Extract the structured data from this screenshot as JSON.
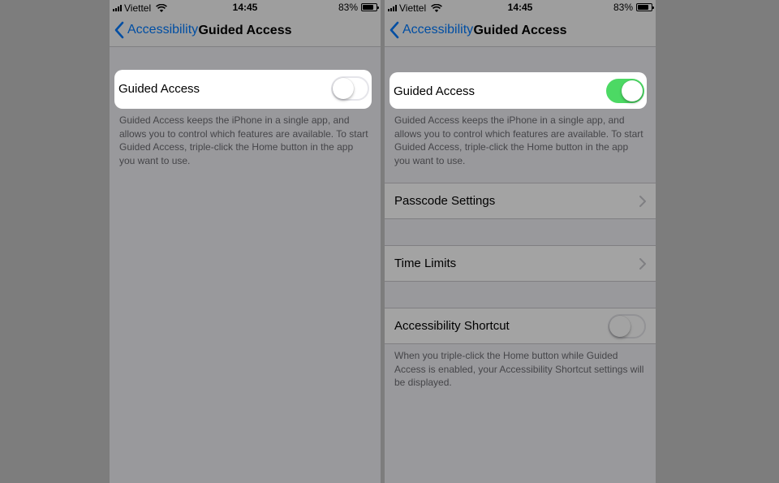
{
  "status_bar": {
    "carrier": "Viettel",
    "time": "14:45",
    "battery_percent": "83%",
    "battery_level": 0.83
  },
  "nav": {
    "back_label": "Accessibility",
    "title": "Guided Access"
  },
  "guided_access": {
    "label": "Guided Access",
    "description": "Guided Access keeps the iPhone in a single app, and allows you to control which features are available. To start Guided Access, triple-click the Home button in the app you want to use."
  },
  "left_screen": {
    "guided_access_enabled": false
  },
  "right_screen": {
    "guided_access_enabled": true,
    "passcode_settings_label": "Passcode Settings",
    "time_limits_label": "Time Limits",
    "accessibility_shortcut_label": "Accessibility Shortcut",
    "accessibility_shortcut_enabled": false,
    "accessibility_shortcut_footer": "When you triple-click the Home button while Guided Access is enabled, your Accessibility Shortcut settings will be displayed."
  },
  "colors": {
    "ios_blue": "#007aff",
    "toggle_green": "#4cd964",
    "group_background": "#efeff4",
    "outer_background": "#7d7d7d"
  }
}
